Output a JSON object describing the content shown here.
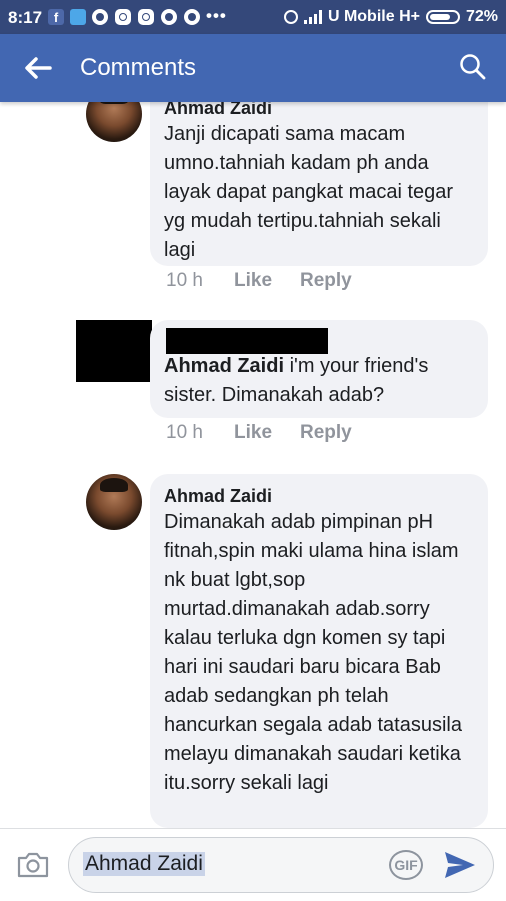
{
  "status_bar": {
    "time": "8:17",
    "dots": "•••",
    "carrier": "U Mobile H+",
    "battery": "72%",
    "notification_icons": [
      "facebook-icon",
      "twitter-icon",
      "whatsapp-icon",
      "instagram-icon",
      "instagram-icon",
      "whatsapp-icon",
      "whatsapp-icon"
    ]
  },
  "app_bar": {
    "title": "Comments",
    "back_icon": "arrow-left-icon",
    "search_icon": "search-icon"
  },
  "comments": [
    {
      "author": "Ahmad Zaidi",
      "text": "Janji dicapati sama macam umno.tahniah kadam ph anda layak dapat pangkat macai tegar yg mudah tertipu.tahniah sekali lagi",
      "time": "10 h",
      "like": "Like",
      "reply": "Reply"
    },
    {
      "author": "",
      "mention": "Ahmad Zaidi",
      "text": " i'm your friend's sister. Dimanakah adab?",
      "time": "10 h",
      "like": "Like",
      "reply": "Reply"
    },
    {
      "author": "Ahmad Zaidi",
      "text": "Dimanakah adab pimpinan pH fitnah,spin maki ulama hina islam nk buat lgbt,sop murtad.dimanakah adab.sorry kalau terluka dgn komen sy tapi hari ini saudari baru bicara Bab adab sedangkan ph telah hancurkan segala adab tatasusila melayu dimanakah saudari ketika itu.sorry sekali lagi"
    }
  ],
  "composer": {
    "value": "Ahmad Zaidi",
    "gif_label": "GIF",
    "camera_icon": "camera-icon",
    "send_icon": "send-icon"
  },
  "colors": {
    "app_bar": "#4267b2",
    "status_bar": "#34487a",
    "bubble": "#f1f2f6",
    "meta": "#90949c"
  }
}
